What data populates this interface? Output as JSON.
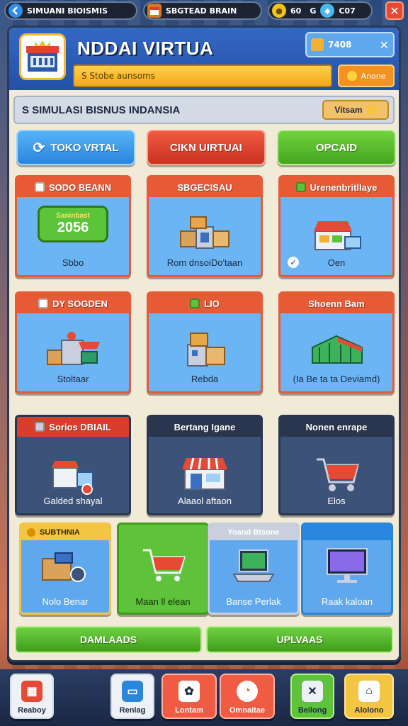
{
  "topbar": {
    "title": "SIMUANI BIOISMIS",
    "shop_label": "SBGTEAD BRAIN",
    "gold_value": "60",
    "gem_label": "G",
    "gem_value": "C07",
    "close_symbol": "✕"
  },
  "header": {
    "title": "NDDAI VIRTUA",
    "mini_value": "7408",
    "mini_close": "✕",
    "subbar_text": "S Stobe aunsoms",
    "subbtn_text": "Anone"
  },
  "subtitle": {
    "text": "S  SIMULASI BISNUS INDANSIA",
    "view_label": "Vitsam"
  },
  "tabs": [
    {
      "label": "TOKO VRTAL"
    },
    {
      "label": "CIKN UIRTUAI"
    },
    {
      "label": "OPCAID"
    }
  ],
  "cards_row1": [
    {
      "head": "SODO BEANN",
      "badge_small": "Saninbast",
      "badge_big": "2056",
      "footer": "Sbbo"
    },
    {
      "head": "SBGECISAU",
      "footer": "Rom dnsoiDo'taan"
    },
    {
      "head": "Urenenbritllaye",
      "footer": "Oen"
    }
  ],
  "cards_row2": [
    {
      "head": "DY SOGDEN",
      "footer": "Stoltaar"
    },
    {
      "head": "LIO",
      "footer": "Rebda"
    },
    {
      "head": "Shoenn Bam",
      "footer": "(Ia Be ta ta Deviamd)"
    }
  ],
  "cards_row3": [
    {
      "head": "Sorios DBIAIL",
      "footer": "Galded shayal"
    },
    {
      "head": "Bertang Igane",
      "footer": "Alaaol aftaon"
    },
    {
      "head": "Nonen enrape",
      "footer": "Elos"
    }
  ],
  "cards_row4": [
    {
      "head": "SUBTHNIA",
      "footer": "Nolo Benar"
    },
    {
      "head": "",
      "footer": "Maan ll elean"
    },
    {
      "head": "Yoand Btsone",
      "footer": "Banse Perlak"
    },
    {
      "head": "",
      "footer": "Raak kaloan"
    }
  ],
  "bottom_buttons": [
    {
      "label": "DAMLAADS"
    },
    {
      "label": "UPLVAAS"
    }
  ],
  "bottom_nav": [
    {
      "label": "Reaboy",
      "icon": "store-icon"
    },
    {
      "label": "Renlag",
      "icon": "tv-icon"
    },
    {
      "label": "Lontam",
      "icon": "cow-icon"
    },
    {
      "label": "Omnaitae",
      "icon": "clock-icon"
    },
    {
      "label": "Beilong",
      "icon": "tools-icon"
    },
    {
      "label": "Alolono",
      "icon": "home-icon"
    }
  ],
  "colors": {
    "accent_blue": "#2986dd",
    "accent_red": "#c9331f",
    "accent_green": "#44a61c",
    "accent_orange": "#f39220",
    "panel_bg": "#f1ead6"
  }
}
